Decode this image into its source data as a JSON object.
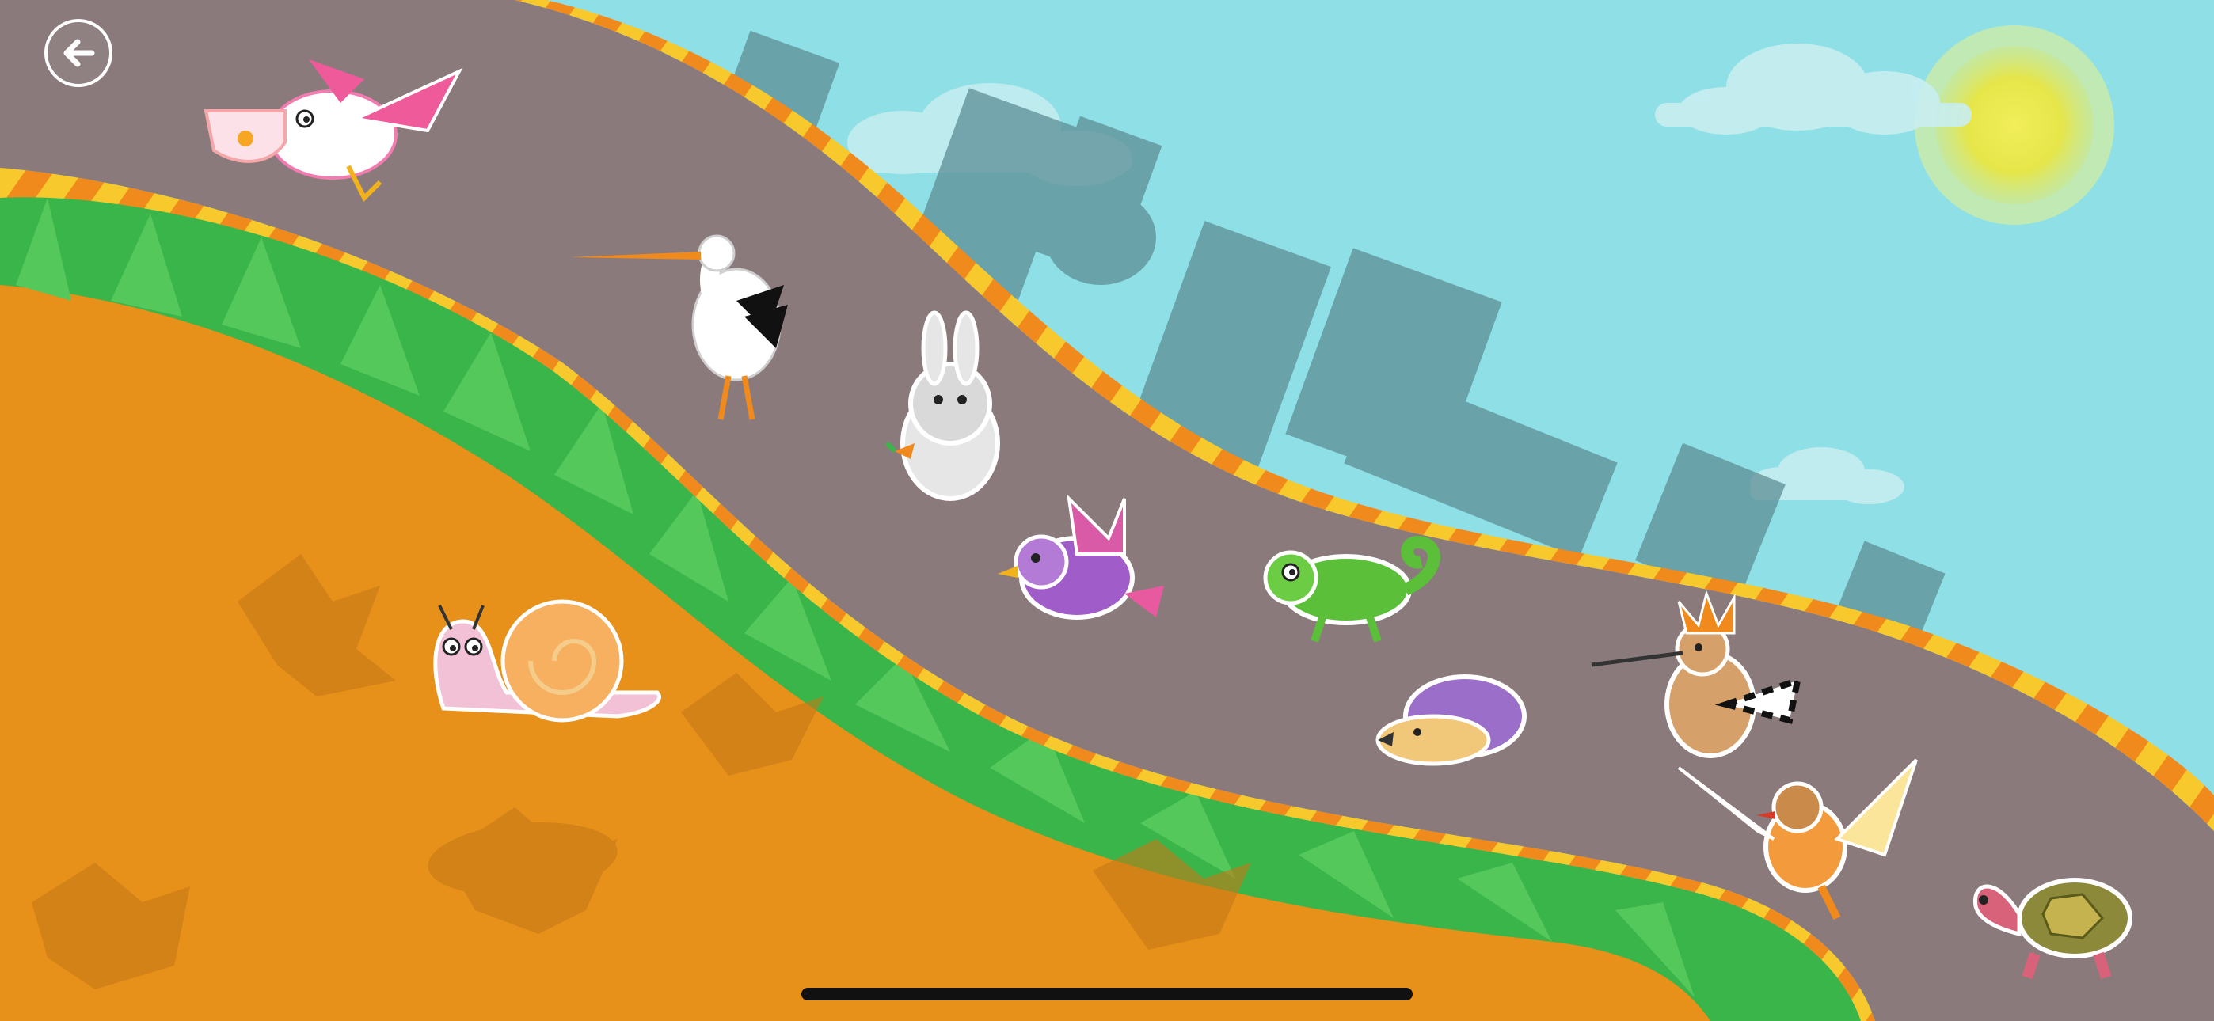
{
  "screen": {
    "type": "kids-animal-race-game",
    "orientation": "landscape"
  },
  "colors": {
    "sky": "#8fe0e6",
    "road": "#8a7a7c",
    "road_stripe_yellow": "#f7c92c",
    "road_stripe_orange": "#f08a1c",
    "grass": "#3ab54a",
    "ground": "#e7901a",
    "sun": "#e9e84a",
    "city_silhouette": "#5e8e96"
  },
  "back_button": {
    "icon": "arrow-left-icon"
  },
  "animals": [
    {
      "id": "pelican",
      "icon": "pelican-icon"
    },
    {
      "id": "stork",
      "icon": "stork-icon"
    },
    {
      "id": "rabbit",
      "icon": "rabbit-icon"
    },
    {
      "id": "purple-bird",
      "icon": "purple-bird-icon"
    },
    {
      "id": "chameleon",
      "icon": "chameleon-icon"
    },
    {
      "id": "hedgehog",
      "icon": "hedgehog-icon"
    },
    {
      "id": "hoopoe",
      "icon": "hoopoe-icon"
    },
    {
      "id": "robin",
      "icon": "robin-icon"
    },
    {
      "id": "tortoise",
      "icon": "tortoise-icon"
    },
    {
      "id": "snail",
      "icon": "snail-icon"
    }
  ]
}
